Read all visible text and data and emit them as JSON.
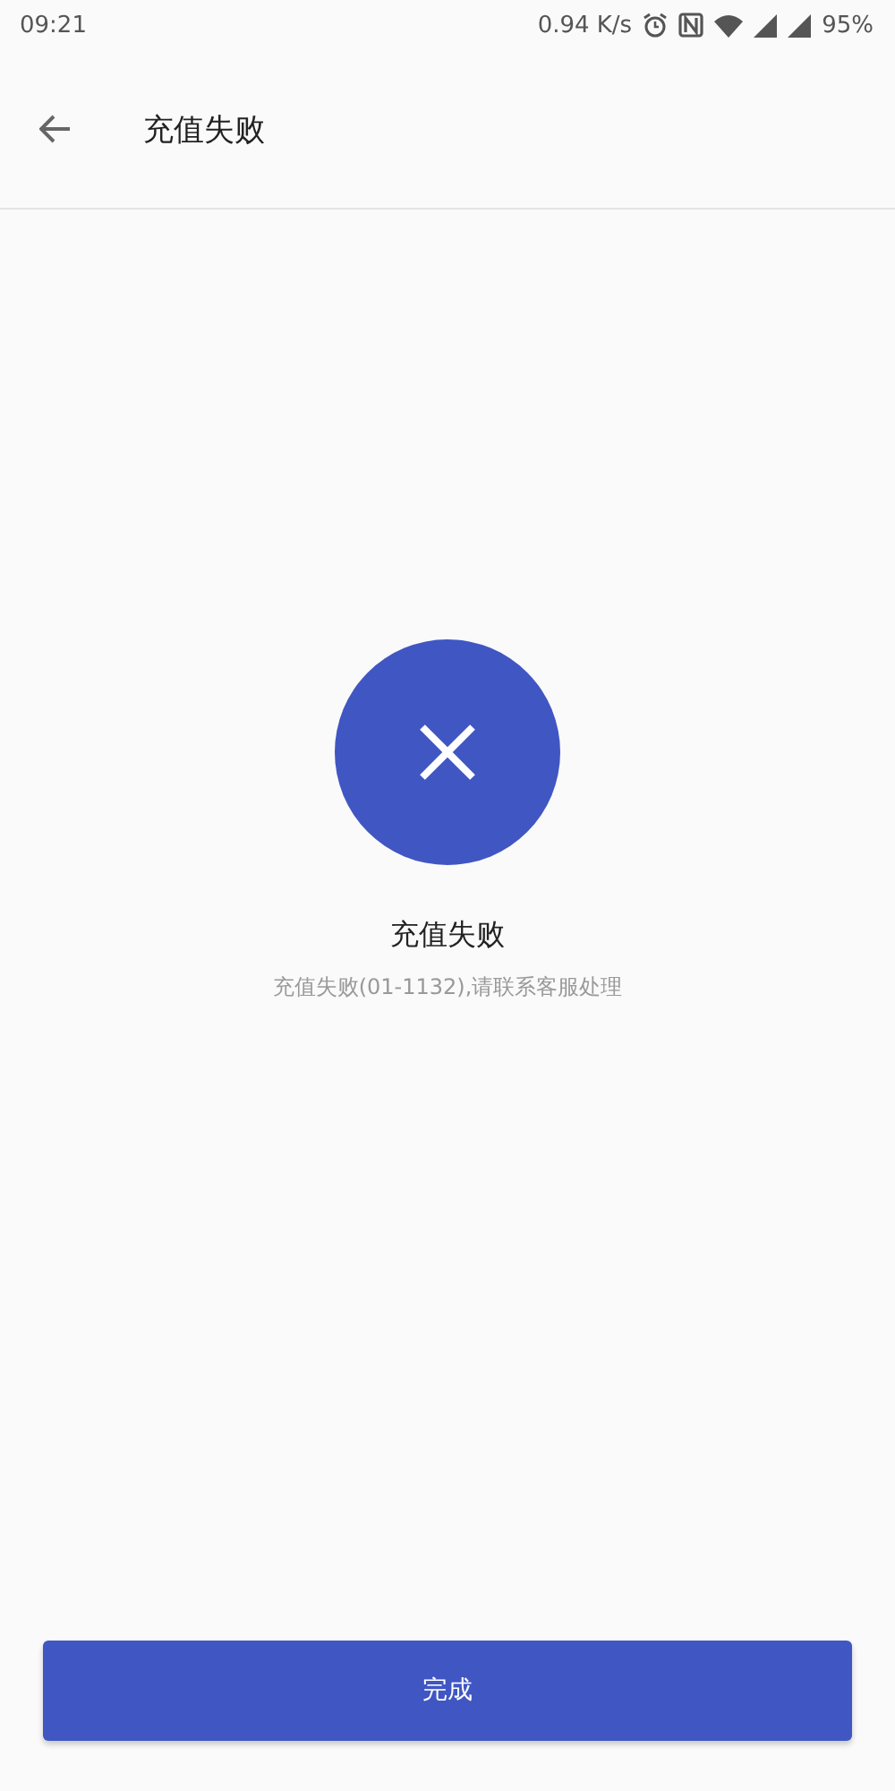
{
  "status_bar": {
    "time": "09:21",
    "net_speed": "0.94 K/s",
    "battery": "95%"
  },
  "header": {
    "title": "充值失败"
  },
  "result": {
    "kind": "failure",
    "title": "充值失败",
    "message": "充值失败(01-1132),请联系客服处理"
  },
  "buttons": [
    "完成"
  ]
}
